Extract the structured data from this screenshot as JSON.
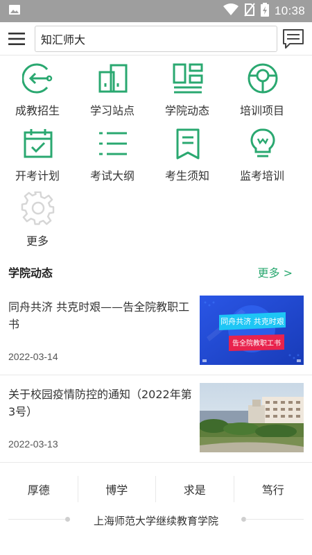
{
  "status_bar": {
    "time": "10:38",
    "icons": [
      "image-icon",
      "wifi-icon",
      "no-sim-icon",
      "battery-icon"
    ]
  },
  "header": {
    "search_value": "知汇师大",
    "menu_icon": "hamburger-icon",
    "message_icon": "message-icon"
  },
  "grid": [
    {
      "label": "成教招生",
      "icon": "enroll-icon"
    },
    {
      "label": "学习站点",
      "icon": "study-site-icon"
    },
    {
      "label": "学院动态",
      "icon": "college-news-icon"
    },
    {
      "label": "培训项目",
      "icon": "training-project-icon"
    },
    {
      "label": "开考计划",
      "icon": "exam-calendar-icon"
    },
    {
      "label": "考试大纲",
      "icon": "exam-outline-icon"
    },
    {
      "label": "考生须知",
      "icon": "candidate-notice-icon"
    },
    {
      "label": "监考培训",
      "icon": "invigilation-training-icon"
    },
    {
      "label": "更多",
      "icon": "gear-icon"
    }
  ],
  "news_section": {
    "title": "学院动态",
    "more": "更多 >",
    "items": [
      {
        "title": "同舟共济 共克时艰——告全院教职工书",
        "date": "2022-03-14",
        "thumb_line1": "同舟共济 共克时艰",
        "thumb_line2": "告全院教职工书"
      },
      {
        "title": "关于校园疫情防控的通知（2022年第3号）",
        "date": "2022-03-13"
      }
    ]
  },
  "footer": {
    "motto": [
      "厚德",
      "博学",
      "求是",
      "笃行"
    ],
    "institution": "上海师范大学继续教育学院"
  },
  "colors": {
    "accent": "#2aa870",
    "status_bar": "#9e9e9e",
    "thumb_blue": "#1f4fd8",
    "thumb_red": "#e8234d"
  }
}
